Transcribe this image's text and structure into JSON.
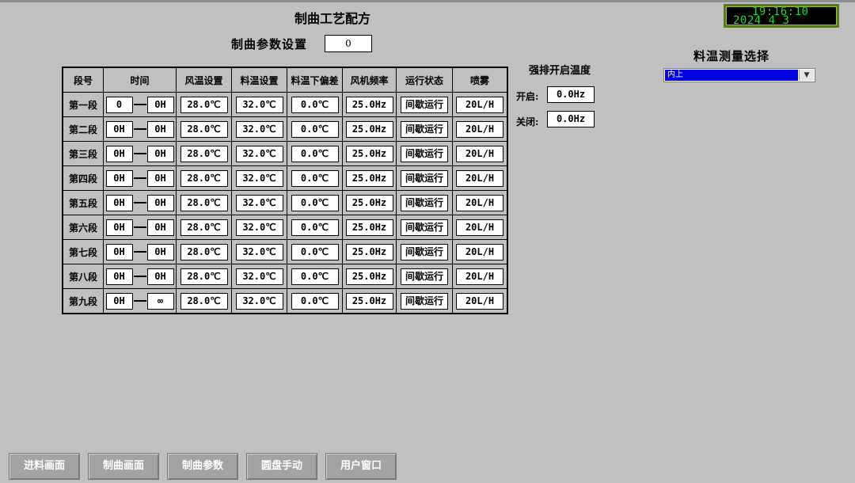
{
  "title": "制曲工艺配方",
  "clock": {
    "time": "19:16:10",
    "date": "2024  4   3"
  },
  "param": {
    "label": "制曲参数设置",
    "value": "0"
  },
  "table": {
    "headers": [
      "段号",
      "时间",
      "风温设置",
      "料温设置",
      "料温下偏差",
      "风机频率",
      "运行状态",
      "喷雾"
    ],
    "rows": [
      {
        "seg": "第一段",
        "t_start": "0",
        "t_end": "0H",
        "air": "28.0℃",
        "mat": "32.0℃",
        "dev": "0.0℃",
        "fan": "25.0Hz",
        "state": "间歇运行",
        "spray": "20L/H"
      },
      {
        "seg": "第二段",
        "t_start": "0H",
        "t_end": "0H",
        "air": "28.0℃",
        "mat": "32.0℃",
        "dev": "0.0℃",
        "fan": "25.0Hz",
        "state": "间歇运行",
        "spray": "20L/H"
      },
      {
        "seg": "第三段",
        "t_start": "0H",
        "t_end": "0H",
        "air": "28.0℃",
        "mat": "32.0℃",
        "dev": "0.0℃",
        "fan": "25.0Hz",
        "state": "间歇运行",
        "spray": "20L/H"
      },
      {
        "seg": "第四段",
        "t_start": "0H",
        "t_end": "0H",
        "air": "28.0℃",
        "mat": "32.0℃",
        "dev": "0.0℃",
        "fan": "25.0Hz",
        "state": "间歇运行",
        "spray": "20L/H"
      },
      {
        "seg": "第五段",
        "t_start": "0H",
        "t_end": "0H",
        "air": "28.0℃",
        "mat": "32.0℃",
        "dev": "0.0℃",
        "fan": "25.0Hz",
        "state": "间歇运行",
        "spray": "20L/H"
      },
      {
        "seg": "第六段",
        "t_start": "0H",
        "t_end": "0H",
        "air": "28.0℃",
        "mat": "32.0℃",
        "dev": "0.0℃",
        "fan": "25.0Hz",
        "state": "间歇运行",
        "spray": "20L/H"
      },
      {
        "seg": "第七段",
        "t_start": "0H",
        "t_end": "0H",
        "air": "28.0℃",
        "mat": "32.0℃",
        "dev": "0.0℃",
        "fan": "25.0Hz",
        "state": "间歇运行",
        "spray": "20L/H"
      },
      {
        "seg": "第八段",
        "t_start": "0H",
        "t_end": "0H",
        "air": "28.0℃",
        "mat": "32.0℃",
        "dev": "0.0℃",
        "fan": "25.0Hz",
        "state": "间歇运行",
        "spray": "20L/H"
      },
      {
        "seg": "第九段",
        "t_start": "0H",
        "t_end": "∞",
        "air": "28.0℃",
        "mat": "32.0℃",
        "dev": "0.0℃",
        "fan": "25.0Hz",
        "state": "间歇运行",
        "spray": "20L/H"
      }
    ]
  },
  "force_exhaust": {
    "title": "强排开启温度",
    "open_label": "开启:",
    "open_value": "0.0Hz",
    "close_label": "关闭:",
    "close_value": "0.0Hz"
  },
  "temp_select": {
    "title": "料温测量选择",
    "selected": "内上",
    "arrow_icon": "chevron-down-icon"
  },
  "nav": [
    {
      "label": "进料画面"
    },
    {
      "label": "制曲画面"
    },
    {
      "label": "制曲参数"
    },
    {
      "label": "圆盘手动"
    },
    {
      "label": "用户窗口"
    }
  ],
  "colors": {
    "background": "#c0c0c0",
    "clock_text": "#22d43a",
    "selection": "#0000e0",
    "nav_button": "#a3a3a3"
  }
}
